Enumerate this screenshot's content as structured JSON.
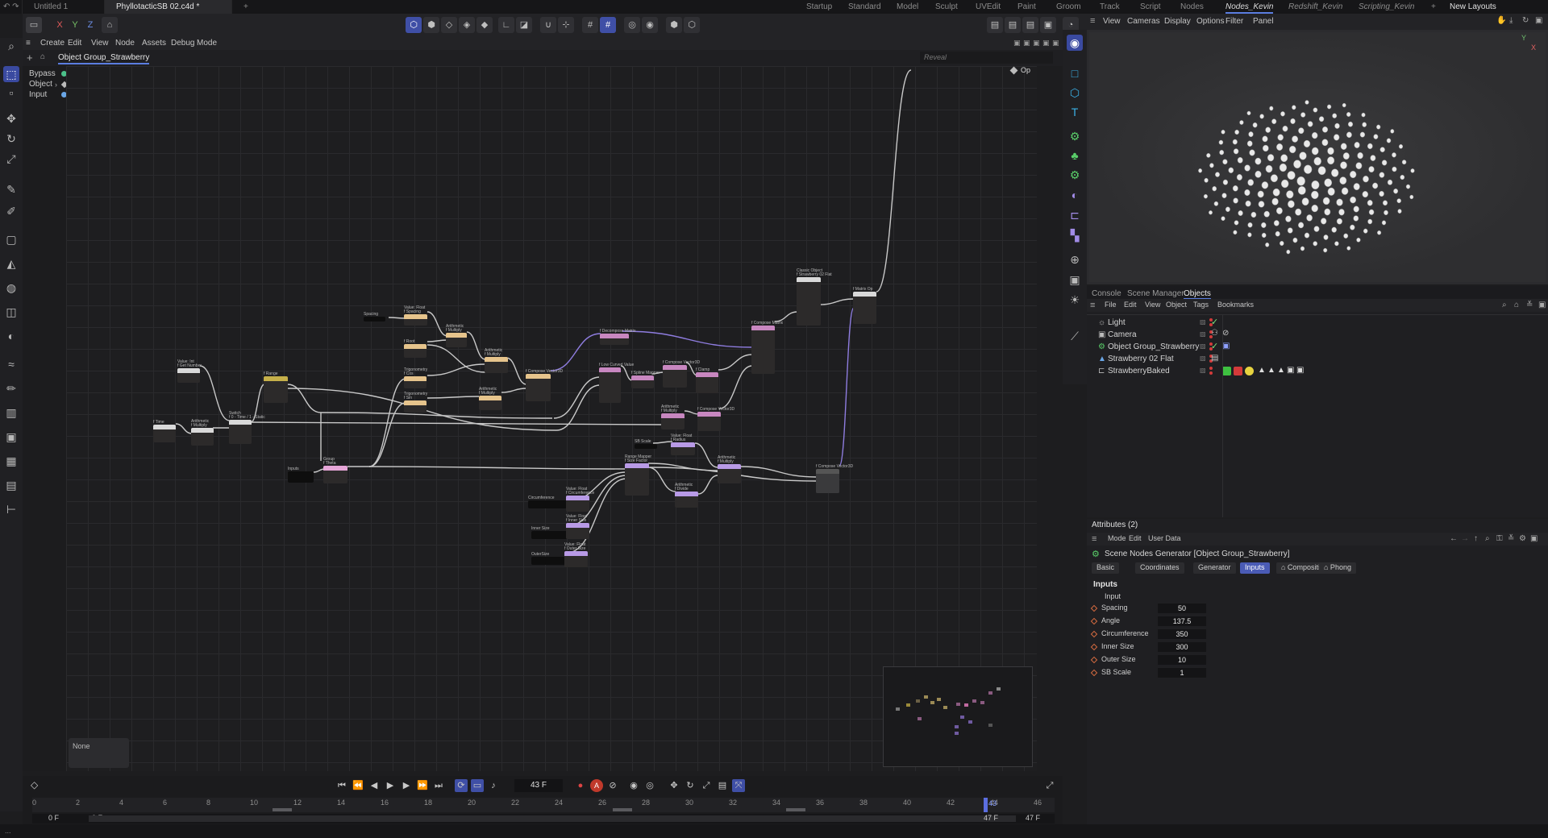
{
  "tabs": {
    "doc1": "Untitled 1",
    "doc2": "PhyllotacticSB 02.c4d *",
    "add": "+"
  },
  "layouts": [
    "Startup",
    "Standard",
    "Model",
    "Sculpt",
    "UVEdit",
    "Paint",
    "Groom",
    "Track",
    "Script",
    "Nodes",
    "Nodes_Kevin",
    "Redshift_Kevin",
    "Scripting_Kevin",
    "+",
    "New Layouts"
  ],
  "axis": {
    "x": "X",
    "y": "Y",
    "z": "Z"
  },
  "nodeMenu": [
    "Create",
    "Edit",
    "View",
    "Node",
    "Assets",
    "Debug",
    "Mode"
  ],
  "breadcrumb": "Object Group_Strawberry",
  "reveal_placeholder": "Reveal",
  "ports": {
    "bypass": "Bypass",
    "object": "Object",
    "input": "Input",
    "op": "Op"
  },
  "nodes": [
    {
      "t": "Spacing",
      "c": "#111111"
    },
    {
      "t": "Value: Float\nf Spacing",
      "c": "#e6c48c"
    },
    {
      "t": "Arithmetic\nf Multiply",
      "c": "#e6c48c"
    },
    {
      "t": "f Root",
      "c": "#e6c48c"
    },
    {
      "t": "Arithmetic\nf Multiply",
      "c": "#e6c48c"
    },
    {
      "t": "Trigonometry\nf Cos",
      "c": "#e6c48c"
    },
    {
      "t": "Trigonometry\nf Sin",
      "c": "#e6c48c"
    },
    {
      "t": "Arithmetic\nf Multiply",
      "c": "#e6c48c"
    },
    {
      "t": "f Compose Vector3D",
      "c": "#e6c48c"
    },
    {
      "t": "f Decompose Matrix",
      "c": "#c887c0"
    },
    {
      "t": "f Low Curved Value",
      "c": "#c887c0"
    },
    {
      "t": "f Spline Mapper",
      "c": "#c887c0"
    },
    {
      "t": "f Compose Vector3D",
      "c": "#c887c0"
    },
    {
      "t": "f Clamp",
      "c": "#c887c0"
    },
    {
      "t": "f Compose Vector3D",
      "c": "#c887c0"
    },
    {
      "t": "Arithmetic\nf Multiply",
      "c": "#c887c0"
    },
    {
      "t": "f Compose Matrix",
      "c": "#c887c0"
    },
    {
      "t": "Classic Object\nf Strawberry 02 Flat",
      "c": "#d9d9d9"
    },
    {
      "t": "f Matrix Op",
      "c": "#d9d9d9"
    },
    {
      "t": "Value: Int\nf Get Number",
      "c": "#d9d9d9"
    },
    {
      "t": "f Time",
      "c": "#d9d9d9"
    },
    {
      "t": "Arithmetic\nf Multiply",
      "c": "#d9d9d9"
    },
    {
      "t": "Switch\nf 0 - Time / 1 - Static",
      "c": "#d9d9d9"
    },
    {
      "t": "f Range",
      "c": "#c6b04a"
    },
    {
      "t": "Group\nf Theta",
      "c": "#e6a6d8"
    },
    {
      "t": "Inputs",
      "c": "#111111"
    },
    {
      "t": "SB Scale",
      "c": "#111111"
    },
    {
      "t": "Value: Float\nf Radius",
      "c": "#b89ae6"
    },
    {
      "t": "Range Mapper\nf Size Factor",
      "c": "#b89ae6"
    },
    {
      "t": "Arithmetic\nf Multiply",
      "c": "#b89ae6"
    },
    {
      "t": "Arithmetic\nf Divide",
      "c": "#b89ae6"
    },
    {
      "t": "Circumference",
      "c": "#111111"
    },
    {
      "t": "Value: Float\nf Circumference",
      "c": "#b89ae6"
    },
    {
      "t": "Inner Size",
      "c": "#111111"
    },
    {
      "t": "Value: Float\nf Inner Size",
      "c": "#b89ae6"
    },
    {
      "t": "OuterSize",
      "c": "#111111"
    },
    {
      "t": "Value: Float\nf Outer Size",
      "c": "#b89ae6"
    },
    {
      "t": "f Compose Vector3D",
      "c": "#555555"
    }
  ],
  "none_box": "None",
  "timeline": {
    "frame": "43 F",
    "start": "0 F",
    "start2": "0 F",
    "end": "47 F",
    "end2": "47 F",
    "current": "43",
    "ticks": [
      "0",
      "2",
      "4",
      "6",
      "8",
      "10",
      "12",
      "14",
      "16",
      "18",
      "20",
      "22",
      "24",
      "26",
      "28",
      "30",
      "32",
      "34",
      "36",
      "38",
      "40",
      "42",
      "44",
      "46"
    ]
  },
  "status": "...",
  "viewport_menu": [
    "View",
    "Cameras",
    "Display",
    "Options",
    "Filter",
    "Panel"
  ],
  "objects_panel": {
    "tabs": [
      "Console",
      "Scene Manager",
      "Objects"
    ],
    "menu": [
      "File",
      "Edit",
      "View",
      "Object",
      "Tags",
      "Bookmarks"
    ],
    "rows": [
      "Light",
      "Camera",
      "Object Group_Strawberry",
      "Strawberry 02 Flat",
      "StrawberryBaked"
    ]
  },
  "attributes": {
    "header": "Attributes (2)",
    "menu": [
      "Mode",
      "Edit",
      "User Data"
    ],
    "title": "Scene Nodes Generator [Object Group_Strawberry]",
    "tabs": [
      "Basic",
      "Coordinates",
      "Generator",
      "Inputs",
      "Compositing",
      "Phong"
    ],
    "section": "Inputs",
    "subsection": "Input",
    "fields": [
      {
        "label": "Spacing",
        "value": "50"
      },
      {
        "label": "Angle",
        "value": "137.5"
      },
      {
        "label": "Circumference",
        "value": "350"
      },
      {
        "label": "Inner Size",
        "value": "300"
      },
      {
        "label": "Outer Size",
        "value": "10"
      },
      {
        "label": "SB Scale",
        "value": "1"
      }
    ]
  },
  "colors": {
    "accent": "#4a5bb5",
    "node_tan": "#e6c48c",
    "node_pink": "#c887c0",
    "node_lilac": "#b89ae6",
    "node_olive": "#c6b04a",
    "green": "#3ec040",
    "red": "#d33a3a",
    "yellow": "#e7d340"
  }
}
